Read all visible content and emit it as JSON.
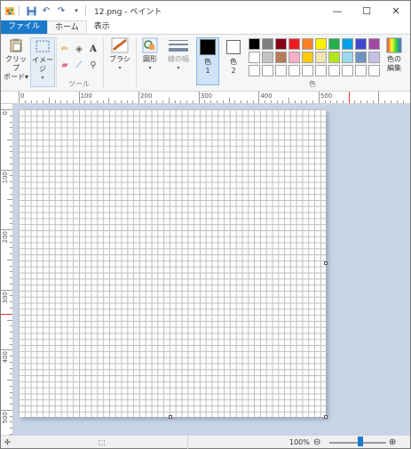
{
  "window": {
    "title": "12.png - ペイント",
    "minimize_glyph": "—",
    "maximize_glyph": "☐",
    "close_glyph": "✕"
  },
  "quick_access": {
    "save_icon": "save-icon",
    "undo_icon": "undo-icon",
    "redo_icon": "redo-icon",
    "customize_icon": "dropdown-arrow-icon"
  },
  "tabs": [
    {
      "label": "ファイル"
    },
    {
      "label": "ホーム"
    },
    {
      "label": "表示"
    }
  ],
  "ribbon": {
    "clipboard": {
      "label_line1": "クリップ",
      "label_line2": "ボード▾"
    },
    "image": {
      "label": "イメージ"
    },
    "tools": {
      "group_label": "ツール"
    },
    "brush": {
      "label": "ブラシ"
    },
    "shapes": {
      "label": "図形"
    },
    "line_width": {
      "label": "線の幅"
    },
    "color1": {
      "label_line1": "色",
      "label_line2": "1",
      "color": "#000000"
    },
    "color2": {
      "label_line1": "色",
      "label_line2": "2",
      "color": "#ffffff"
    },
    "colors": {
      "group_label": "色",
      "palette_row1": [
        "#000000",
        "#7f7f7f",
        "#880015",
        "#ed1c24",
        "#ff7f27",
        "#fff200",
        "#22b14c",
        "#00a2e8",
        "#3f48cc",
        "#a349a4"
      ],
      "palette_row2": [
        "#ffffff",
        "#c3c3c3",
        "#b97a57",
        "#ffaec9",
        "#ffc90e",
        "#efe4b0",
        "#b5e61d",
        "#99d9ea",
        "#7092be",
        "#c8bfe7"
      ],
      "palette_row3": [
        "#ffffff",
        "#ffffff",
        "#ffffff",
        "#ffffff",
        "#ffffff",
        "#ffffff",
        "#ffffff",
        "#ffffff",
        "#ffffff",
        "#ffffff"
      ]
    },
    "edit_colors": {
      "label_line1": "色の",
      "label_line2": "編集"
    }
  },
  "ruler": {
    "h_labels": [
      "0",
      "100",
      "200",
      "300",
      "400",
      "500"
    ],
    "v_labels": [
      "0",
      "100",
      "200",
      "300",
      "400",
      "500"
    ]
  },
  "status": {
    "zoom": "100%",
    "zoom_fraction": 0.55
  }
}
